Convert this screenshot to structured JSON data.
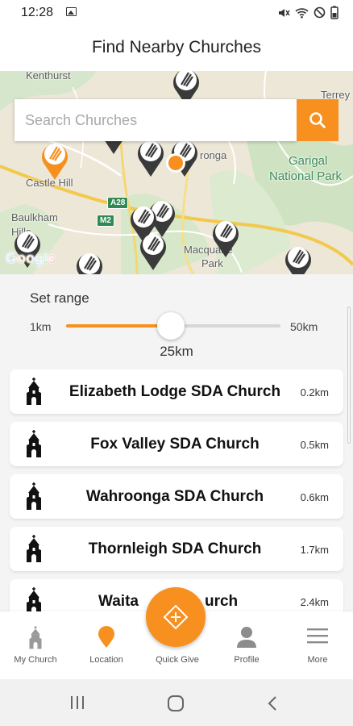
{
  "status_bar": {
    "time": "12:28"
  },
  "header": {
    "title": "Find Nearby Churches"
  },
  "search": {
    "placeholder": "Search Churches"
  },
  "map": {
    "labels": {
      "kenthurst": "Kenthurst",
      "terrey": "Terrey",
      "castle_hill": "Castle Hill",
      "baulkham": "Baulkham",
      "hills": "Hills",
      "ronga": "ronga",
      "garigal": "Garigal",
      "national_park": "National Park",
      "macquarie": "Macquarie",
      "park": "Park"
    },
    "road_badges": {
      "a28": "A28",
      "m2": "M2"
    },
    "attribution": "Google",
    "pin_color": "#3a3a3a",
    "selected_pin_color": "#f7901e"
  },
  "range": {
    "label": "Set range",
    "min_label": "1km",
    "max_label": "50km",
    "value_label": "25km",
    "value_fraction": 0.49
  },
  "churches": [
    {
      "name": "Elizabeth Lodge SDA Church",
      "distance": "0.2km"
    },
    {
      "name": "Fox Valley SDA Church",
      "distance": "0.5km"
    },
    {
      "name": "Wahroonga SDA Church",
      "distance": "0.6km"
    },
    {
      "name": "Thornleigh SDA Church",
      "distance": "1.7km"
    },
    {
      "name": "Waita",
      "name_tail": "urch",
      "distance": "2.4km"
    }
  ],
  "nav": {
    "my_church": "My Church",
    "location": "Location",
    "quick_give": "Quick Give",
    "profile": "Profile",
    "more": "More",
    "active_color": "#f7901e"
  },
  "colors": {
    "accent": "#f7901e"
  }
}
